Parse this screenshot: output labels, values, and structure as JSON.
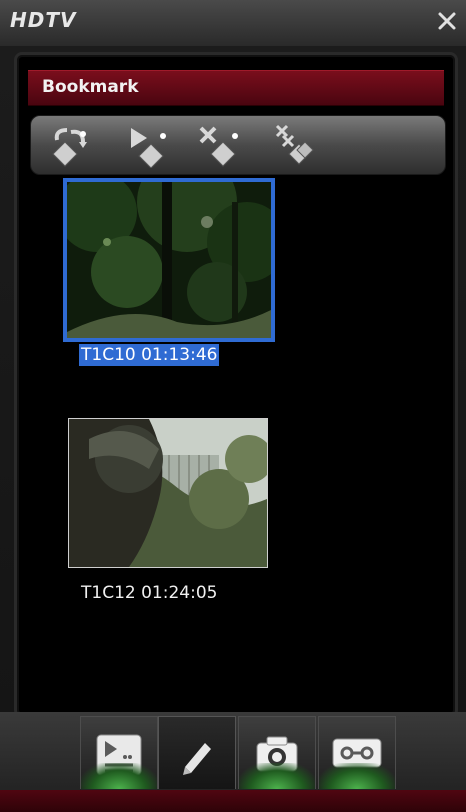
{
  "window": {
    "title": "HDTV"
  },
  "panel": {
    "header": "Bookmark"
  },
  "toolbar": {
    "buttons": [
      {
        "name": "refresh-bookmark-icon"
      },
      {
        "name": "play-bookmark-icon"
      },
      {
        "name": "delete-bookmark-icon"
      },
      {
        "name": "delete-all-bookmarks-icon"
      }
    ]
  },
  "bookmarks": [
    {
      "label": "T1C10 01:13:46",
      "selected": true
    },
    {
      "label": "T1C12 01:24:05",
      "selected": false
    }
  ],
  "tabs": [
    {
      "name": "playlist-icon",
      "active": false
    },
    {
      "name": "pen-icon",
      "active": true
    },
    {
      "name": "camera-icon",
      "active": false
    },
    {
      "name": "tape-record-icon",
      "active": false
    }
  ],
  "colors": {
    "accent": "#7a0e1c",
    "selection": "#2f6bd3",
    "tab_glow": "#4db34d"
  }
}
